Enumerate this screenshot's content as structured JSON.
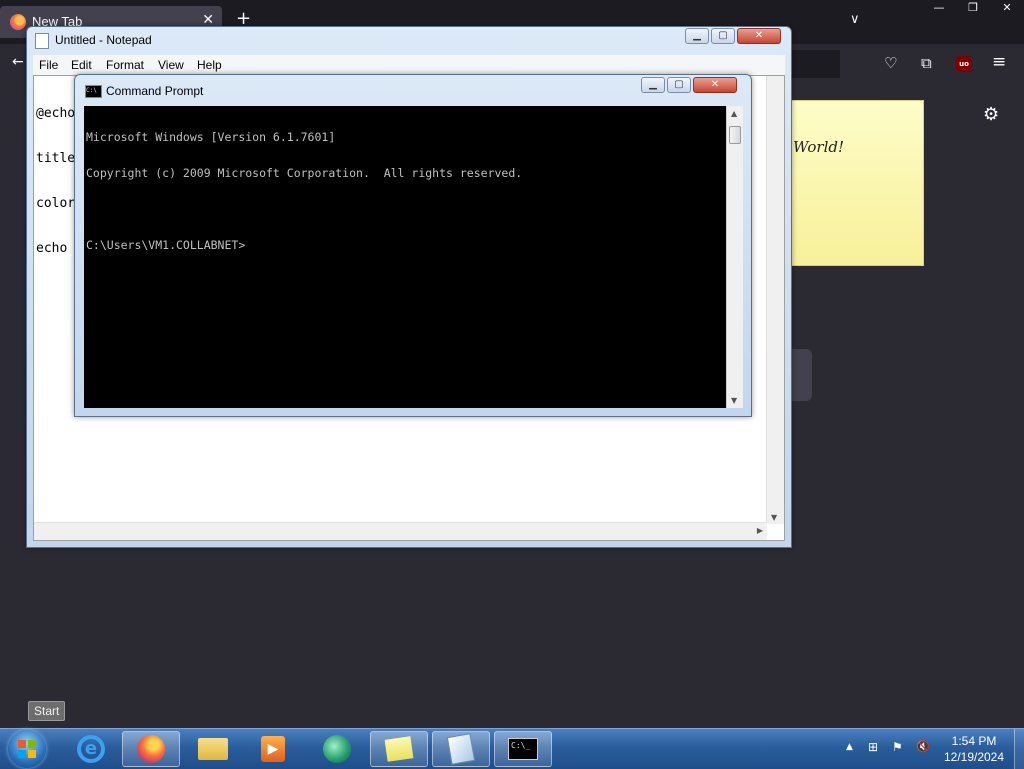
{
  "firefox": {
    "tab_title": "New Tab",
    "tab_close": "✕",
    "new_tab": "+",
    "list_tabs": "∨",
    "win_minimize": "—",
    "win_restore": "❐",
    "win_close": "✕",
    "back": "←",
    "pocket_icon": "♡",
    "extensions_icon": "⧉",
    "ublock_label": "uo",
    "menu_icon": "≡",
    "settings_icon": "⚙"
  },
  "sticky_note": {
    "text": "World!",
    "color": "#fcf6a4"
  },
  "notepad": {
    "title": "Untitled - Notepad",
    "menu": [
      "File",
      "Edit",
      "Format",
      "View",
      "Help"
    ],
    "lines": [
      "@echo",
      "title",
      "color",
      "echo"
    ],
    "buttons": {
      "minimize": "▁",
      "maximize": "▢",
      "close": "✕"
    }
  },
  "cmd": {
    "title": "Command Prompt",
    "icon_text": "C:\\",
    "lines": [
      "Microsoft Windows [Version 6.1.7601]",
      "Copyright (c) 2009 Microsoft Corporation.  All rights reserved.",
      "",
      "C:\\Users\\VM1.COLLABNET>"
    ],
    "buttons": {
      "minimize": "▁",
      "maximize": "▢",
      "close": "✕"
    }
  },
  "taskbar": {
    "start_tooltip": "Start",
    "items": [
      {
        "name": "internet-explorer",
        "glyph": "e"
      },
      {
        "name": "firefox"
      },
      {
        "name": "windows-explorer"
      },
      {
        "name": "media-player",
        "glyph": "▶"
      },
      {
        "name": "green-app"
      },
      {
        "name": "sticky-notes"
      },
      {
        "name": "notepad"
      },
      {
        "name": "command-prompt",
        "glyph": "C:\\_"
      }
    ],
    "tray": {
      "show_hidden": "▲",
      "network": "⊞",
      "action_center": "⚑",
      "volume": "🔇"
    },
    "clock": {
      "time": "1:54 PM",
      "date": "12/19/2024"
    }
  }
}
